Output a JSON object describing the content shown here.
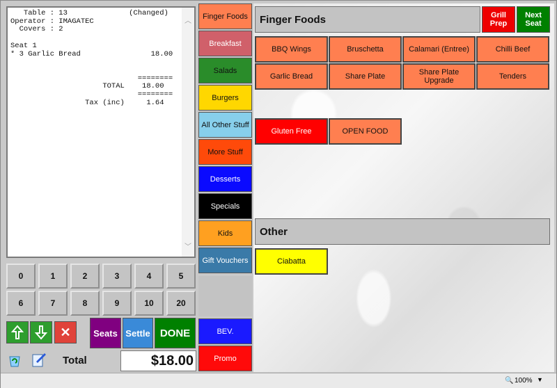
{
  "receipt": {
    "lines": [
      "   Table : 13              (Changed)",
      "Operator : IMAGATEC",
      "  Covers : 2",
      "",
      "Seat 1",
      "* 3 Garlic Bread                18.00",
      "",
      "",
      "                             ========",
      "                     TOTAL    18.00",
      "                             ========",
      "                 Tax (inc)     1.64"
    ]
  },
  "keypad": {
    "row1": [
      "0",
      "1",
      "2",
      "3",
      "4",
      "5"
    ],
    "row2": [
      "6",
      "7",
      "8",
      "9",
      "10",
      "20"
    ]
  },
  "actions": {
    "seats": "Seats",
    "settle": "Settle",
    "done": "DONE"
  },
  "total": {
    "label": "Total",
    "value": "$18.00"
  },
  "categories": [
    {
      "label": "Finger Foods",
      "bg": "#ff7f50",
      "fg": "#111111"
    },
    {
      "label": "Breakfast",
      "bg": "#d0606a",
      "fg": "#ffffff"
    },
    {
      "label": "Salads",
      "bg": "#2a8c2a",
      "fg": "#111111"
    },
    {
      "label": "Burgers",
      "bg": "#ffd700",
      "fg": "#111111"
    },
    {
      "label": "All Other Stuff",
      "bg": "#87cfeb",
      "fg": "#111111"
    },
    {
      "label": "More Stuff",
      "bg": "#ff4a0a",
      "fg": "#111111"
    },
    {
      "label": "Desserts",
      "bg": "#0a0aff",
      "fg": "#ffffff"
    },
    {
      "label": "Specials",
      "bg": "#000000",
      "fg": "#ffffff"
    },
    {
      "label": "Kids",
      "bg": "#ffa020",
      "fg": "#111111"
    },
    {
      "label": "Gift Vouchers",
      "bg": "#3a7aa8",
      "fg": "#ffffff"
    }
  ],
  "bottom_categories": [
    {
      "label": "BEV.",
      "bg": "#1a1aff",
      "fg": "#ffffff"
    },
    {
      "label": "Promo",
      "bg": "#ff0a0a",
      "fg": "#ffffff"
    }
  ],
  "section_finger": {
    "title": "Finger Foods",
    "grill": "Grill\nPrep",
    "next": "Next\nSeat"
  },
  "finger_items": [
    "BBQ Wings",
    "Bruschetta",
    "Calamari (Entree)",
    "Chilli Beef",
    "Garlic Bread",
    "Share Plate",
    "Share Plate Upgrade",
    "Tenders"
  ],
  "special_items": [
    {
      "label": "Gluten Free",
      "bg": "#ff0000",
      "fg": "#ffffff"
    },
    {
      "label": "OPEN FOOD",
      "bg": "#ff7f50",
      "fg": "#111111"
    }
  ],
  "section_other": {
    "title": "Other"
  },
  "other_items": [
    {
      "label": "Ciabatta",
      "bg": "#ffff00",
      "fg": "#111111"
    }
  ],
  "status": {
    "zoom": "100%"
  },
  "colors": {
    "item": "#ff7f50",
    "grill": "#ee0000",
    "next": "#008000",
    "seats": "#800080",
    "settle": "#3a8ad8",
    "done": "#008000"
  }
}
